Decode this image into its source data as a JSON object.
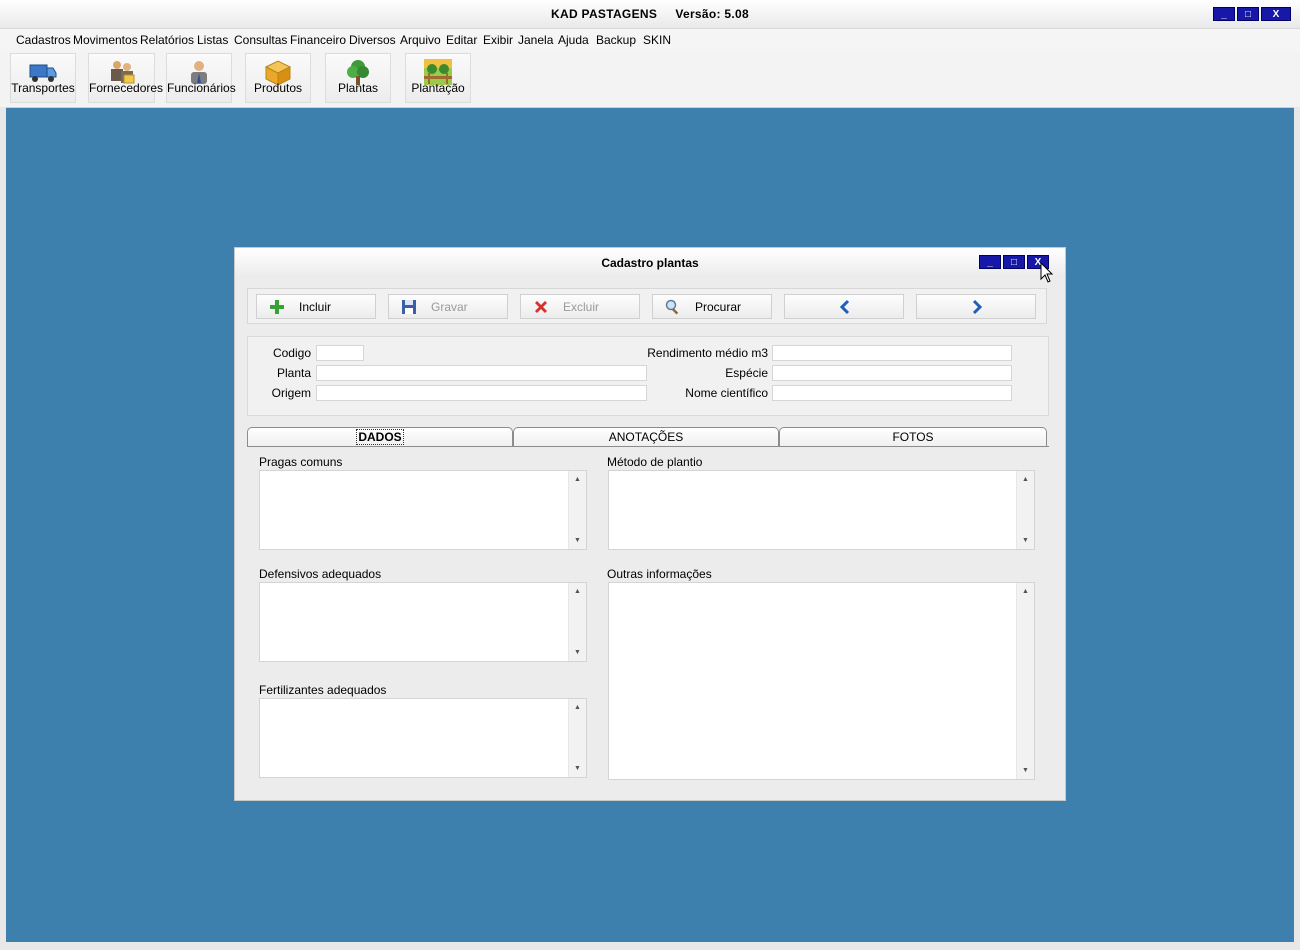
{
  "app": {
    "title": "KAD PASTAGENS",
    "version": "Versão: 5.08"
  },
  "menu": [
    "Cadastros",
    "Movimentos",
    "Relatórios",
    "Listas",
    "Consultas",
    "Financeiro",
    "Diversos",
    "Arquivo",
    "Editar",
    "Exibir",
    "Janela",
    "Ajuda",
    "Backup",
    "SKIN"
  ],
  "toolbar": [
    {
      "label": "Transportes",
      "icon": "truck-icon"
    },
    {
      "label": "Fornecedores",
      "icon": "suppliers-icon"
    },
    {
      "label": "Funcionários",
      "icon": "employee-icon"
    },
    {
      "label": "Produtos",
      "icon": "box-icon"
    },
    {
      "label": "Plantas",
      "icon": "tree-icon"
    },
    {
      "label": "Plantação",
      "icon": "plantation-icon"
    }
  ],
  "window_buttons": {
    "minimize": "_",
    "maximize": "□",
    "close": "X"
  },
  "dialog": {
    "title": "Cadastro plantas",
    "actions": [
      {
        "label": "Incluir",
        "icon": "plus-icon",
        "enabled": true
      },
      {
        "label": "Gravar",
        "icon": "save-icon",
        "enabled": false
      },
      {
        "label": "Excluir",
        "icon": "delete-icon",
        "enabled": false
      },
      {
        "label": "Procurar",
        "icon": "search-icon",
        "enabled": true
      },
      {
        "label": "",
        "icon": "chevron-left-icon",
        "enabled": true
      },
      {
        "label": "",
        "icon": "chevron-right-icon",
        "enabled": true
      }
    ],
    "fields": {
      "codigo": {
        "label": "Codigo",
        "value": ""
      },
      "planta": {
        "label": "Planta",
        "value": ""
      },
      "origem": {
        "label": "Origem",
        "value": ""
      },
      "rendimento": {
        "label": "Rendimento médio m3",
        "value": ""
      },
      "especie": {
        "label": "Espécie",
        "value": ""
      },
      "nome_cientifico": {
        "label": "Nome científico",
        "value": ""
      }
    },
    "tabs": [
      "DADOS",
      "ANOTAÇÕES",
      "FOTOS"
    ],
    "active_tab": "DADOS",
    "memos": {
      "pragas": "Pragas comuns",
      "metodo": "Método de plantio",
      "defensivos": "Defensivos adequados",
      "outras": "Outras informações",
      "fertilizantes": "Fertilizantes adequados"
    }
  },
  "colors": {
    "desktop": "#3d7fad",
    "title_button": "#1818a8"
  }
}
